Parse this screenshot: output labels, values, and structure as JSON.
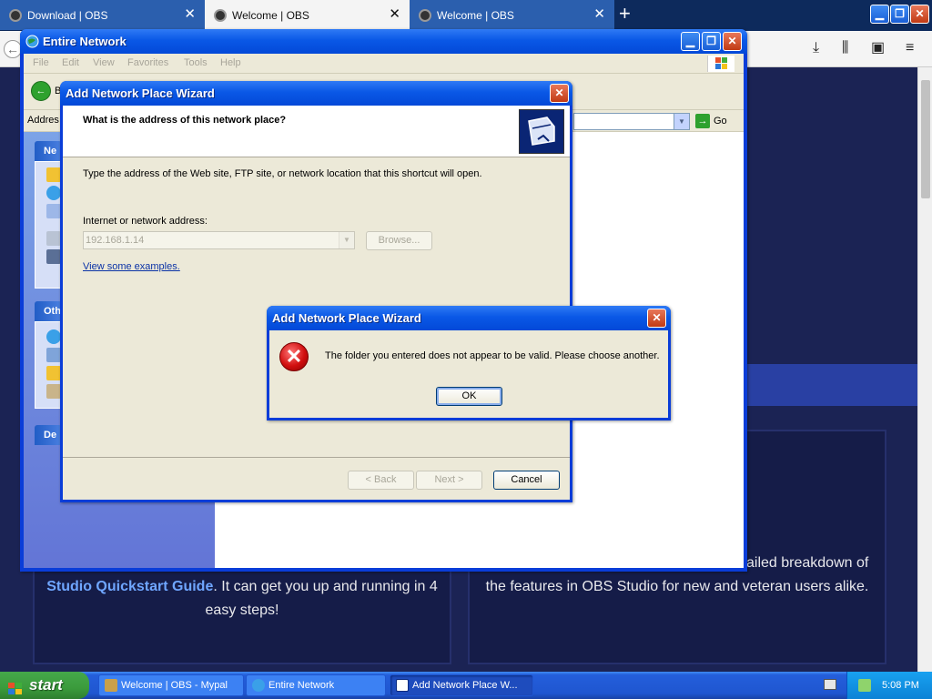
{
  "browser": {
    "tabs": [
      {
        "title": "Download | OBS",
        "active": false
      },
      {
        "title": "Welcome | OBS",
        "active": true
      },
      {
        "title": "Welcome | OBS",
        "active": false
      }
    ],
    "new_tab_label": "+"
  },
  "obs_page": {
    "left_link": "Studio Quickstart Guide",
    "left_text_1": ". It can get you up and running in 4",
    "left_text_2": "easy steps!",
    "right_text_1": "ailed breakdown of",
    "right_text_2": "the features in OBS Studio for new and veteran users alike."
  },
  "explorer": {
    "title": "Entire Network",
    "menu": [
      "File",
      "Edit",
      "View",
      "Favorites",
      "Tools",
      "Help"
    ],
    "back_label": "B",
    "address_label": "Addres",
    "go_label": "Go",
    "taskpane_head_1": "Ne",
    "taskpane_head_2": "Oth",
    "taskpane_head_3": "De"
  },
  "wizard": {
    "title": "Add Network Place Wizard",
    "heading": "What is the address of this network place?",
    "description": "Type the address of the Web site, FTP site, or network location that this shortcut will open.",
    "address_label": "Internet or network address:",
    "address_value": "192.168.1.14",
    "browse_label": "Browse...",
    "examples_link": "View some examples.",
    "back_label": "< Back",
    "next_label": "Next >",
    "cancel_label": "Cancel"
  },
  "error_dialog": {
    "title": "Add Network Place Wizard",
    "message": "The folder you entered does not appear to be valid.  Please choose another.",
    "ok_label": "OK",
    "icon": "error-icon"
  },
  "taskbar": {
    "start_label": "start",
    "items": [
      {
        "label": "Welcome | OBS - Mypal",
        "active": false
      },
      {
        "label": "Entire Network",
        "active": false
      },
      {
        "label": "Add Network Place W...",
        "active": true
      }
    ],
    "clock": "5:08 PM"
  },
  "colors": {
    "xp_title_blue": "#0a58e6",
    "xp_dialog_face": "#ece9d8",
    "obs_background": "#1b2354",
    "error_red": "#d10f0f",
    "start_green": "#3b9b3c"
  }
}
